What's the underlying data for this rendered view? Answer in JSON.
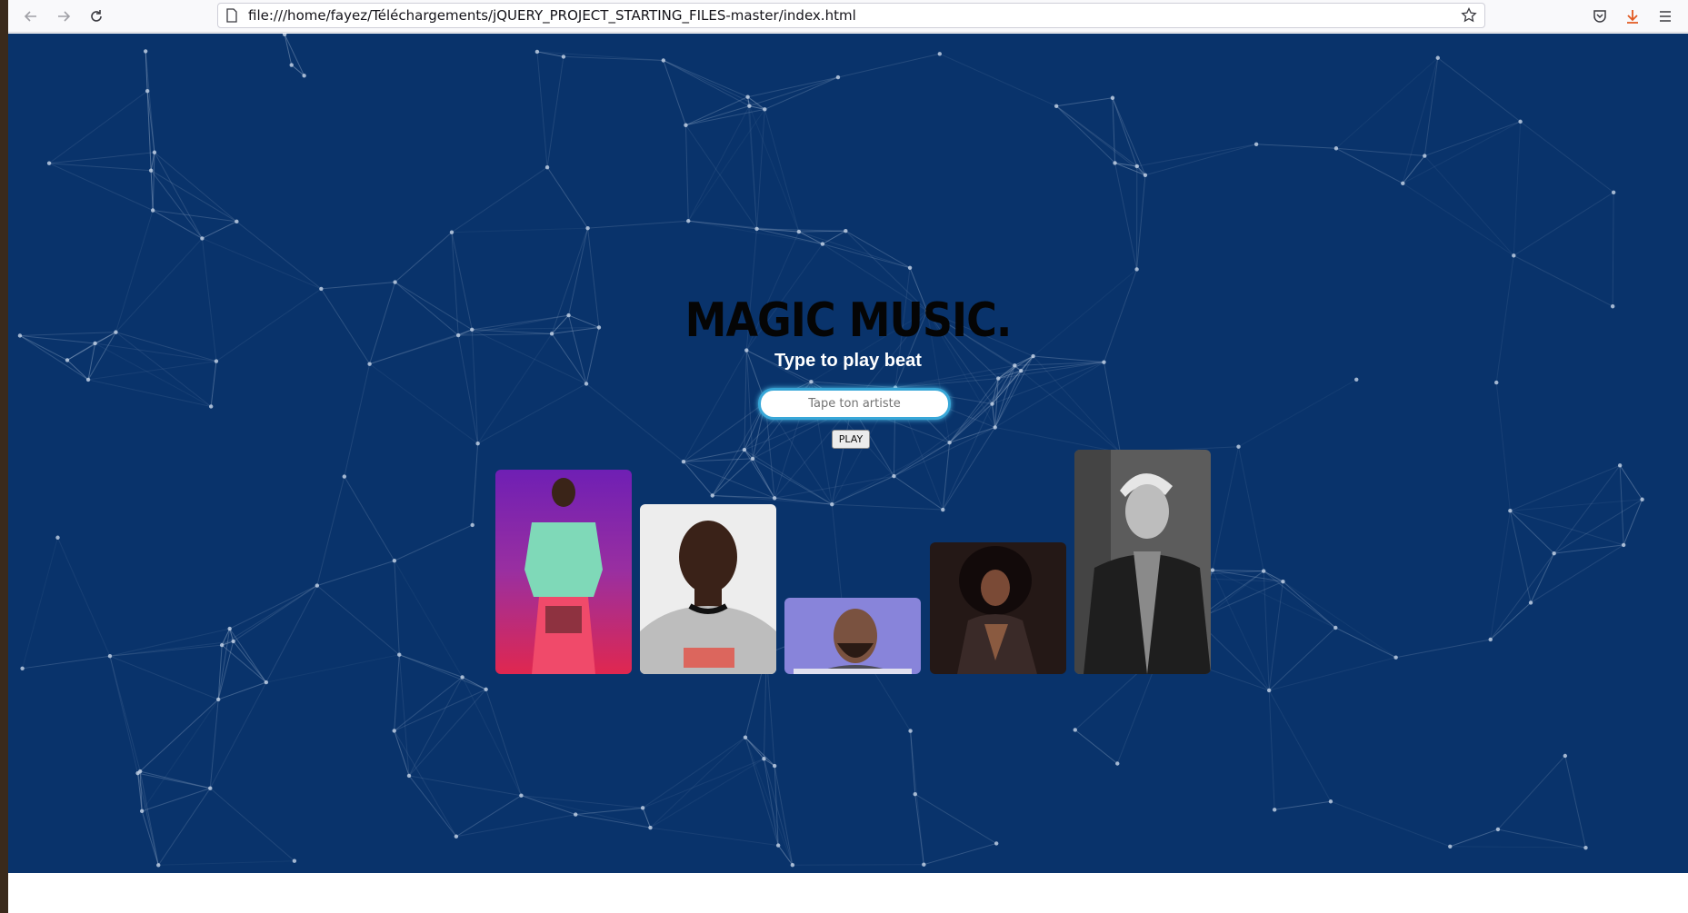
{
  "browser": {
    "url": "file:///home/fayez/Téléchargements/jQUERY_PROJECT_STARTING_FILES-master/index.html",
    "icons": [
      "back-icon",
      "forward-icon",
      "reload-icon",
      "page-icon",
      "bookmark-star-icon",
      "pocket-icon",
      "download-icon",
      "menu-icon"
    ]
  },
  "page": {
    "logo_text": "MAGIC MUSIC.",
    "subtitle": "Type to play beat",
    "search": {
      "placeholder": "Tape ton artiste",
      "value": ""
    },
    "play_label": "PLAY",
    "background_color": "#09336b",
    "artists": [
      {
        "id": "artist-1",
        "tone": "#c24a7a"
      },
      {
        "id": "artist-2",
        "tone": "#c9c9c9"
      },
      {
        "id": "artist-3",
        "tone": "#8a86d8"
      },
      {
        "id": "artist-4",
        "tone": "#2a1e1c"
      },
      {
        "id": "artist-5",
        "tone": "#7a7a7a"
      }
    ]
  }
}
